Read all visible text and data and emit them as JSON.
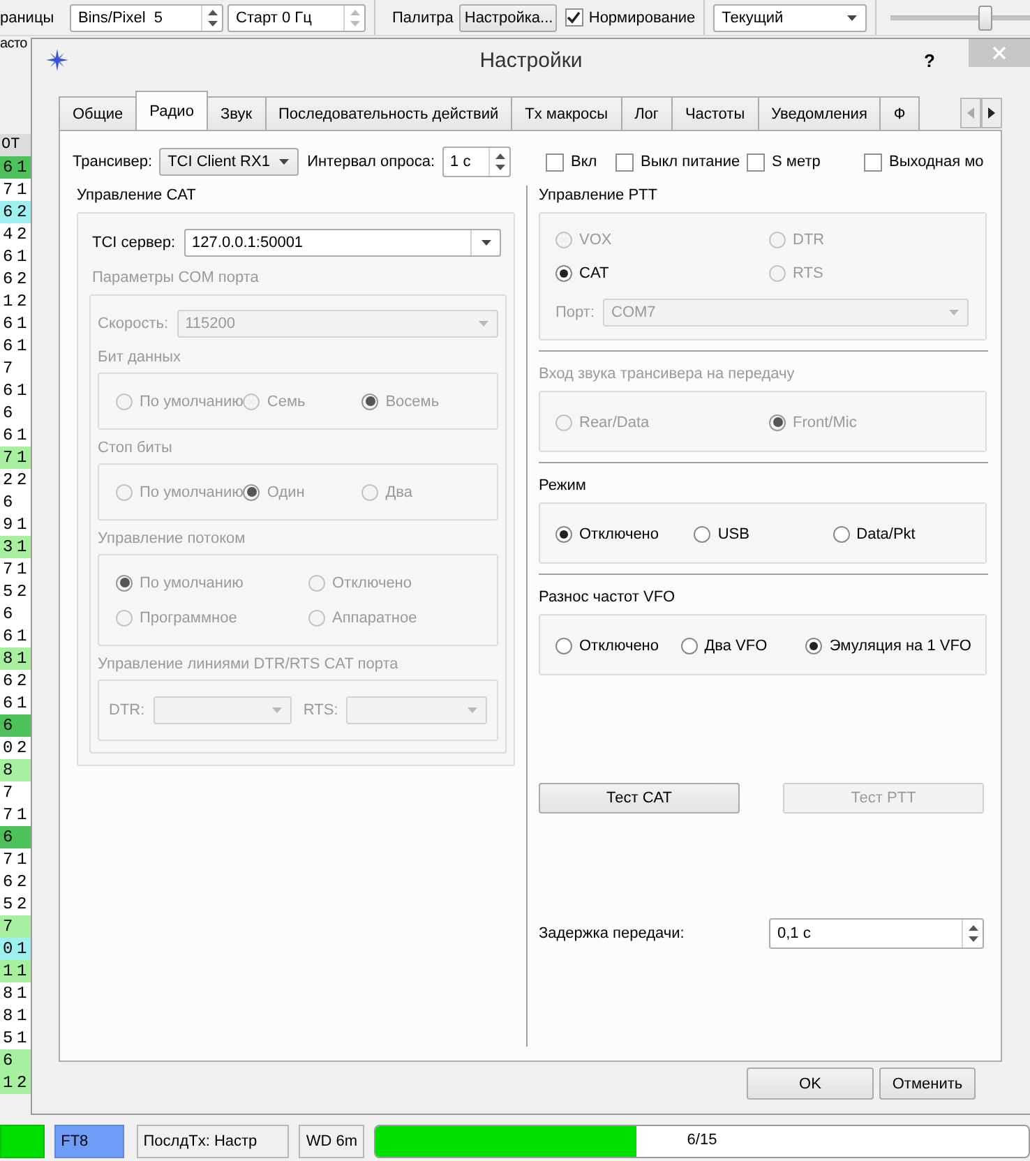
{
  "background_toolbar": {
    "cut_label": "раницы",
    "bins_spin": {
      "label": "Bins/Pixel",
      "value": "5"
    },
    "start_spin": {
      "value": "Старт 0 Гц"
    },
    "palette_label": "Палитра",
    "palette_button": "Настройка...",
    "normalize": {
      "label": "Нормирование",
      "checked": true
    },
    "mode_combo": {
      "value": "Текущий"
    },
    "slider": {
      "level": 0.67
    }
  },
  "decode_column": {
    "cut_label": "асто",
    "header": "OT",
    "rows": [
      {
        "cells": [
          "6",
          "1"
        ],
        "color": "#4cc35a"
      },
      {
        "cells": [
          "7",
          "1"
        ],
        "color": "#ffffff"
      },
      {
        "cells": [
          "6",
          "2"
        ],
        "color": "#9cf0f0"
      },
      {
        "cells": [
          "4",
          "2"
        ],
        "color": "#ffffff"
      },
      {
        "cells": [
          "6",
          "1"
        ],
        "color": "#ffffff"
      },
      {
        "cells": [
          "6",
          "2"
        ],
        "color": "#ffffff"
      },
      {
        "cells": [
          "1",
          "2"
        ],
        "color": "#ffffff"
      },
      {
        "cells": [
          "6",
          "1"
        ],
        "color": "#ffffff"
      },
      {
        "cells": [
          "6",
          "1"
        ],
        "color": "#ffffff"
      },
      {
        "cells": [
          "7"
        ],
        "color": "#ffffff"
      },
      {
        "cells": [
          "6",
          "1"
        ],
        "color": "#ffffff"
      },
      {
        "cells": [
          "6"
        ],
        "color": "#ffffff"
      },
      {
        "cells": [
          "6",
          "1"
        ],
        "color": "#ffffff"
      },
      {
        "cells": [
          "7",
          "1"
        ],
        "color": "#a6f0a0"
      },
      {
        "cells": [
          "2",
          "2"
        ],
        "color": "#ffffff"
      },
      {
        "cells": [
          "6"
        ],
        "color": "#ffffff"
      },
      {
        "cells": [
          "9",
          "1"
        ],
        "color": "#ffffff"
      },
      {
        "cells": [
          "3",
          "1"
        ],
        "color": "#a6f0a0"
      },
      {
        "cells": [
          "7",
          "1"
        ],
        "color": "#ffffff"
      },
      {
        "cells": [
          "5",
          "2"
        ],
        "color": "#ffffff"
      },
      {
        "cells": [
          "6"
        ],
        "color": "#ffffff"
      },
      {
        "cells": [
          "6",
          "1"
        ],
        "color": "#ffffff"
      },
      {
        "cells": [
          "8",
          "1"
        ],
        "color": "#a6f0a0"
      },
      {
        "cells": [
          "6",
          "2"
        ],
        "color": "#ffffff"
      },
      {
        "cells": [
          "6",
          "1"
        ],
        "color": "#ffffff"
      },
      {
        "cells": [
          "6"
        ],
        "color": "#4cc35a"
      },
      {
        "cells": [
          "0",
          "2"
        ],
        "color": "#ffffff"
      },
      {
        "cells": [
          "8"
        ],
        "color": "#a6f0a0"
      },
      {
        "cells": [
          "7"
        ],
        "color": "#ffffff"
      },
      {
        "cells": [
          "7",
          "1"
        ],
        "color": "#ffffff"
      },
      {
        "cells": [
          "6"
        ],
        "color": "#4cc35a"
      },
      {
        "cells": [
          "7",
          "1"
        ],
        "color": "#ffffff"
      },
      {
        "cells": [
          "6",
          "2"
        ],
        "color": "#ffffff"
      },
      {
        "cells": [
          "5",
          "2"
        ],
        "color": "#ffffff"
      },
      {
        "cells": [
          "7"
        ],
        "color": "#a6f0a0"
      },
      {
        "cells": [
          "0",
          "1"
        ],
        "color": "#9cf0f0"
      },
      {
        "cells": [
          "1",
          "1"
        ],
        "color": "#a6f0a0"
      },
      {
        "cells": [
          "8",
          "1"
        ],
        "color": "#ffffff"
      },
      {
        "cells": [
          "8",
          "1"
        ],
        "color": "#ffffff"
      },
      {
        "cells": [
          "5",
          "1"
        ],
        "color": "#ffffff"
      },
      {
        "cells": [
          "6"
        ],
        "color": "#a6f0a0"
      },
      {
        "cells": [
          "1",
          "2"
        ],
        "color": "#a6f0a0"
      }
    ]
  },
  "dialog": {
    "title": "Настройки",
    "help": "?",
    "tabs": [
      {
        "label": "Общие",
        "selected": false
      },
      {
        "label": "Радио",
        "selected": true
      },
      {
        "label": "Звук",
        "selected": false
      },
      {
        "label": "Последовательность действий",
        "selected": false
      },
      {
        "label": "Tx макросы",
        "selected": false
      },
      {
        "label": "Лог",
        "selected": false
      },
      {
        "label": "Частоты",
        "selected": false
      },
      {
        "label": "Уведомления",
        "selected": false
      },
      {
        "label": "Ф",
        "selected": false
      }
    ],
    "transceiver": {
      "label": "Трансивер:",
      "value": "TCI Client RX1"
    },
    "poll_interval": {
      "label": "Интервал опроса:",
      "value": "1 с"
    },
    "checkboxes": [
      {
        "label": "Вкл",
        "checked": false
      },
      {
        "label": "Выкл питание",
        "checked": false
      },
      {
        "label": "S метр",
        "checked": false
      },
      {
        "label": "Выходная мо",
        "checked": false
      }
    ],
    "cat": {
      "title": "Управление CAT",
      "server": {
        "label": "TCI сервер:",
        "value": "127.0.0.1:50001"
      },
      "com_port": {
        "title": "Параметры COM порта",
        "disabled": true,
        "speed": {
          "label": "Скорость:",
          "value": "115200"
        },
        "groups": [
          {
            "title": "Бит данных",
            "rows": [
              [
                {
                  "label": "По умолчанию",
                  "selected": false
                },
                {
                  "label": "Семь",
                  "selected": false
                },
                {
                  "label": "Восемь",
                  "selected": true
                }
              ]
            ]
          },
          {
            "title": "Стоп биты",
            "rows": [
              [
                {
                  "label": "По умолчанию",
                  "selected": false
                },
                {
                  "label": "Один",
                  "selected": true
                },
                {
                  "label": "Два",
                  "selected": false
                }
              ]
            ]
          },
          {
            "title": "Управление потоком",
            "rows": [
              [
                {
                  "label": "По умолчанию",
                  "selected": true
                },
                {
                  "label": "Отключено",
                  "selected": false
                }
              ],
              [
                {
                  "label": "Программное",
                  "selected": false
                },
                {
                  "label": "Аппаратное",
                  "selected": false
                }
              ]
            ]
          }
        ],
        "lines": {
          "title": "Управление линиями DTR/RTS CAT порта",
          "dtr_label": "DTR:",
          "rts_label": "RTS:"
        }
      }
    },
    "ptt": {
      "title": "Управление PTT",
      "disabled": false,
      "rows": [
        [
          {
            "label": "VOX",
            "selected": false,
            "disabled": true
          },
          {
            "label": "DTR",
            "selected": false,
            "disabled": true
          }
        ],
        [
          {
            "label": "CAT",
            "selected": true,
            "disabled": false
          },
          {
            "label": "RTS",
            "selected": false,
            "disabled": true
          }
        ]
      ],
      "port": {
        "label": "Порт:",
        "value": "COM7",
        "disabled": true
      }
    },
    "audio_input": {
      "title": "Вход звука трансивера на передачу",
      "disabled": true,
      "rows": [
        [
          {
            "label": "Rear/Data",
            "selected": false
          },
          {
            "label": "Front/Mic",
            "selected": true
          }
        ]
      ]
    },
    "mode": {
      "title": "Режим",
      "disabled": false,
      "rows": [
        [
          {
            "label": "Отключено",
            "selected": true
          },
          {
            "label": "USB",
            "selected": false
          },
          {
            "label": "Data/Pkt",
            "selected": false
          }
        ]
      ]
    },
    "split": {
      "title": "Разнос частот VFO",
      "disabled": false,
      "rows": [
        [
          {
            "label": "Отключено",
            "selected": false
          },
          {
            "label": "Два VFO",
            "selected": false
          },
          {
            "label": "Эмуляция на 1 VFO",
            "selected": true
          }
        ]
      ]
    },
    "test_buttons": [
      {
        "label": "Тест CAT",
        "disabled": false
      },
      {
        "label": "Тест PTT",
        "disabled": true
      }
    ],
    "tx_delay": {
      "label": "Задержка передачи:",
      "value": "0,1 с"
    },
    "footer_buttons": [
      "OK",
      "Отменить"
    ]
  },
  "status_bar": {
    "mode": "FT8",
    "last_tx": "ПослдTx: Настр",
    "wd": "WD 6m",
    "progress": {
      "level": 0.4,
      "text": "6/15"
    }
  }
}
